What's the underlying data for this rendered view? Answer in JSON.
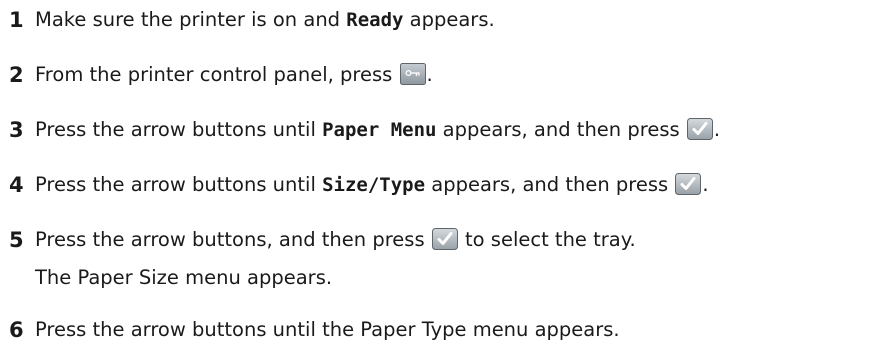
{
  "steps": [
    {
      "num": "1",
      "pre": "Make sure the printer is on and ",
      "code": "Ready",
      "post": " appears."
    },
    {
      "num": "2",
      "pre": "From the printer control panel, press ",
      "post": "."
    },
    {
      "num": "3",
      "pre": "Press the arrow buttons until ",
      "code": "Paper Menu",
      "mid": " appears, and then press ",
      "post": "."
    },
    {
      "num": "4",
      "pre": "Press the arrow buttons until ",
      "code": "Size/Type",
      "mid": " appears, and then press ",
      "post": "."
    },
    {
      "num": "5",
      "pre": "Press the arrow buttons, and then press ",
      "post": " to select the tray.",
      "note": "The Paper Size menu appears."
    },
    {
      "num": "6",
      "text": "Press the arrow buttons until the Paper Type menu appears."
    }
  ],
  "icons": {
    "menu_button": "menu-key-icon",
    "select_button": "select-checkmark-icon"
  },
  "colors": {
    "select_button": "#5a9e4a",
    "menu_button": "#9aa3ab"
  }
}
